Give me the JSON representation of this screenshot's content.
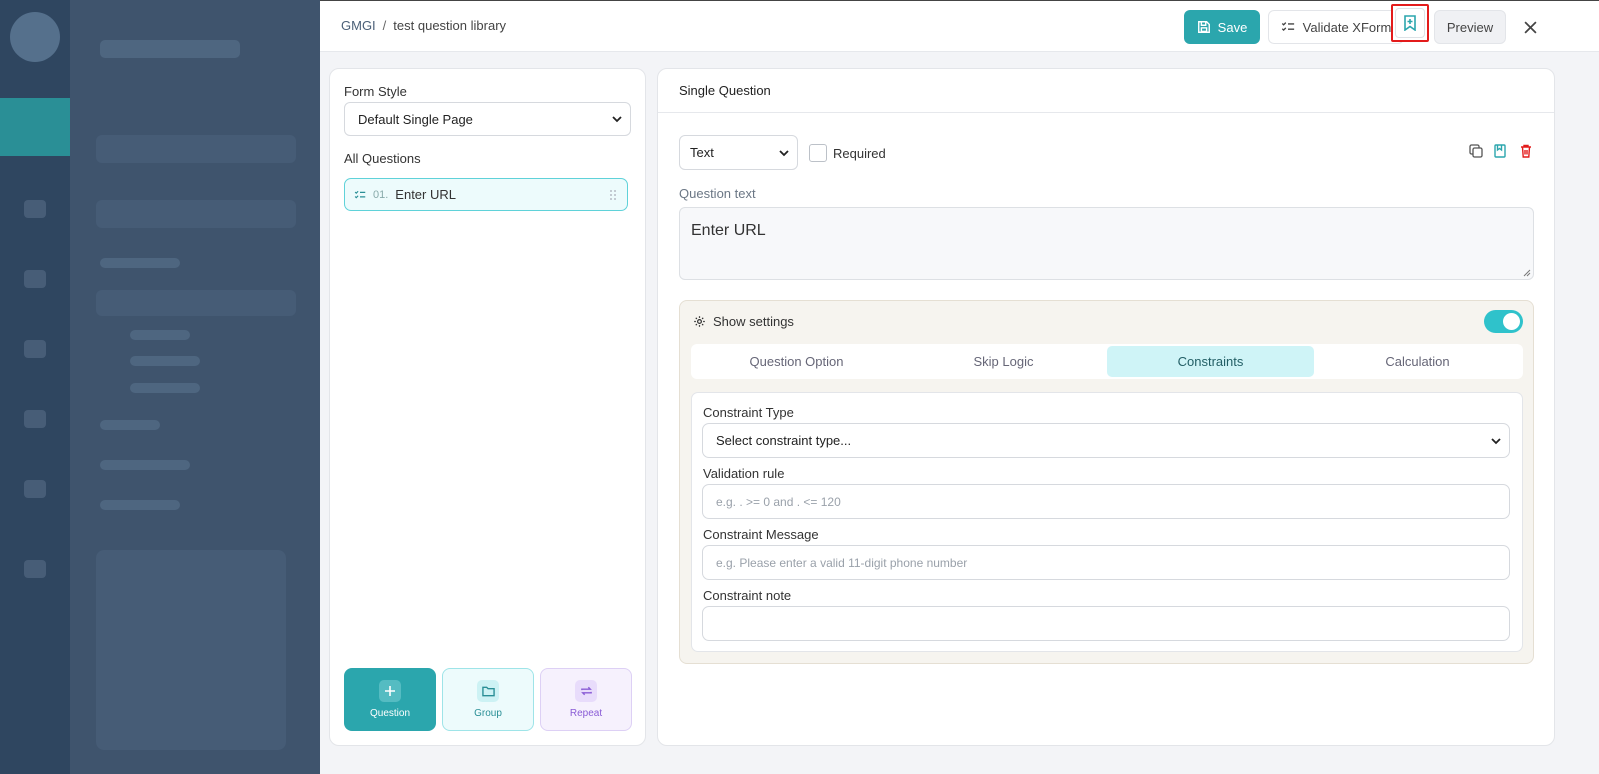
{
  "breadcrumb": {
    "home": "GMGI",
    "separator": "/",
    "current": "test question library"
  },
  "toolbar": {
    "save_label": "Save",
    "validate_label": "Validate XForm",
    "preview_label": "Preview"
  },
  "left": {
    "form_style_label": "Form Style",
    "form_style_value": "Default Single Page",
    "all_questions_label": "All Questions",
    "questions": [
      {
        "number": "01.",
        "title": "Enter URL"
      }
    ],
    "add_buttons": {
      "question": "Question",
      "group": "Group",
      "repeat": "Repeat"
    }
  },
  "right": {
    "header": "Single Question",
    "question_type": "Text",
    "required_label": "Required",
    "required_checked": false,
    "question_text_label": "Question text",
    "question_text_value": "Enter URL",
    "settings": {
      "title": "Show settings",
      "enabled": true,
      "tabs": [
        "Question Option",
        "Skip Logic",
        "Constraints",
        "Calculation"
      ],
      "active_tab": "Constraints"
    },
    "constraints": {
      "type_label": "Constraint Type",
      "type_value": "Select constraint type...",
      "rule_label": "Validation rule",
      "rule_placeholder": "e.g. . >= 0 and . <= 120",
      "message_label": "Constraint Message",
      "message_placeholder": "e.g. Please enter a valid 11-digit phone number",
      "note_label": "Constraint note",
      "note_value": ""
    }
  },
  "colors": {
    "accent": "#2ba6ad",
    "danger": "#e31b1b",
    "active_tab_bg": "#cff4f7"
  }
}
